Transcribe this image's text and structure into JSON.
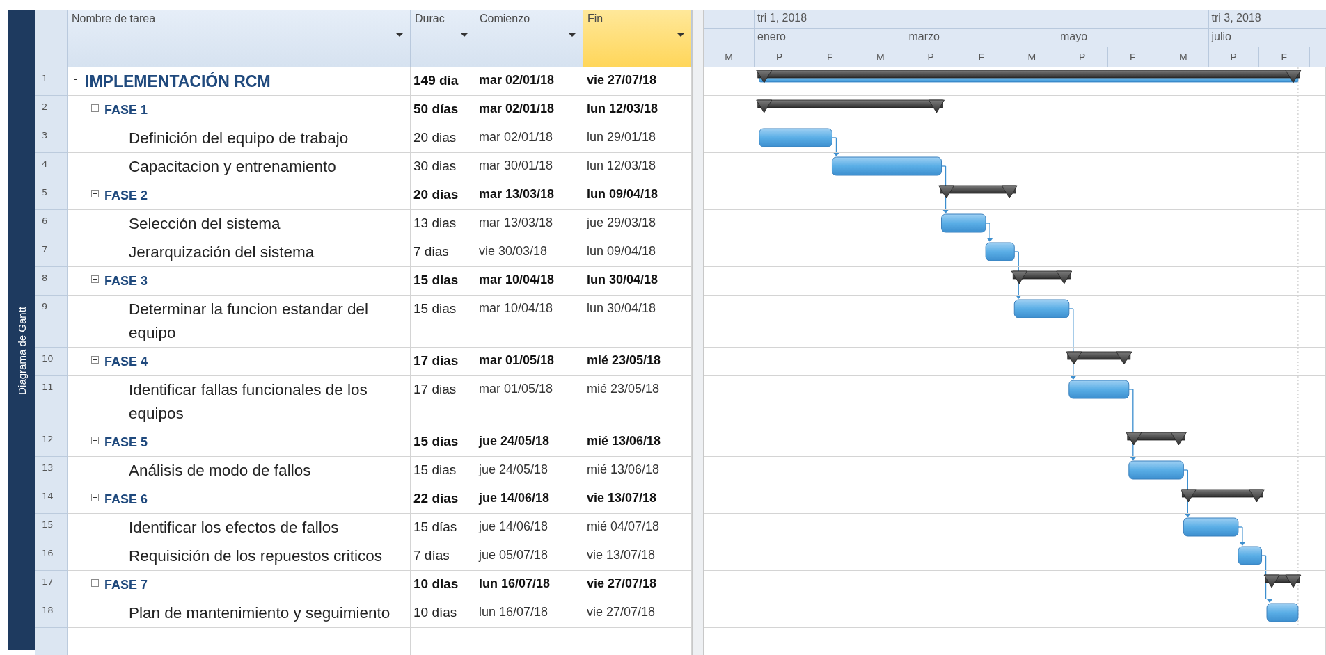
{
  "side_label": "Diagrama de Gantt",
  "table": {
    "columns": [
      {
        "label": "Nombre de tarea",
        "selected": false
      },
      {
        "label": "Durac",
        "selected": false
      },
      {
        "label": "Comienzo",
        "selected": false
      },
      {
        "label": "Fin",
        "selected": true
      }
    ],
    "rows": [
      {
        "id": "1",
        "name": "IMPLEMENTACIÓN RCM",
        "duration": "149 día",
        "start": "mar 02/01/18",
        "finish": "vie 27/07/18",
        "kind": "summary",
        "expanded": true,
        "children": [
          {
            "id": "2",
            "name": "FASE 1",
            "duration": "50 días",
            "start": "mar 02/01/18",
            "finish": "lun 12/03/18",
            "kind": "summary",
            "expanded": true,
            "children": [
              {
                "id": "3",
                "name": "Definición del equipo de trabajo",
                "duration": "20 dias",
                "start": "mar 02/01/18",
                "finish": "lun 29/01/18",
                "kind": "task"
              },
              {
                "id": "4",
                "name": "Capacitacion y entrenamiento",
                "duration": "30 dias",
                "start": "mar 30/01/18",
                "finish": "lun 12/03/18",
                "kind": "task"
              }
            ]
          },
          {
            "id": "5",
            "name": "FASE 2",
            "duration": "20 dias",
            "start": "mar 13/03/18",
            "finish": "lun 09/04/18",
            "kind": "summary",
            "expanded": true,
            "children": [
              {
                "id": "6",
                "name": "Selección del sistema",
                "duration": "13 dias",
                "start": "mar 13/03/18",
                "finish": "jue 29/03/18",
                "kind": "task"
              },
              {
                "id": "7",
                "name": "Jerarquización del sistema",
                "duration": "7 dias",
                "start": "vie 30/03/18",
                "finish": "lun 09/04/18",
                "kind": "task"
              }
            ]
          },
          {
            "id": "8",
            "name": "FASE 3",
            "duration": "15 dias",
            "start": "mar 10/04/18",
            "finish": "lun 30/04/18",
            "kind": "summary",
            "expanded": true,
            "children": [
              {
                "id": "9",
                "name": "Determinar la funcion estandar del equipo",
                "duration": "15 dias",
                "start": "mar 10/04/18",
                "finish": "lun 30/04/18",
                "kind": "task"
              }
            ]
          },
          {
            "id": "10",
            "name": "FASE 4",
            "duration": "17 dias",
            "start": "mar 01/05/18",
            "finish": "mié 23/05/18",
            "kind": "summary",
            "expanded": true,
            "children": [
              {
                "id": "11",
                "name": "Identificar fallas funcionales de los equipos",
                "duration": "17 dias",
                "start": "mar 01/05/18",
                "finish": "mié 23/05/18",
                "kind": "task"
              }
            ]
          },
          {
            "id": "12",
            "name": "FASE 5",
            "duration": "15 dias",
            "start": "jue 24/05/18",
            "finish": "mié 13/06/18",
            "kind": "summary",
            "expanded": true,
            "children": [
              {
                "id": "13",
                "name": "Análisis de modo de fallos",
                "duration": "15 dias",
                "start": "jue 24/05/18",
                "finish": "mié 13/06/18",
                "kind": "task"
              }
            ]
          },
          {
            "id": "14",
            "name": "FASE 6",
            "duration": "22 dias",
            "start": "jue 14/06/18",
            "finish": "vie 13/07/18",
            "kind": "summary",
            "expanded": true,
            "children": [
              {
                "id": "15",
                "name": "Identificar los efectos de fallos",
                "duration": "15 días",
                "start": "jue 14/06/18",
                "finish": "mié 04/07/18",
                "kind": "task"
              },
              {
                "id": "16",
                "name": "Requisición de los repuestos criticos",
                "duration": "7 días",
                "start": "jue 05/07/18",
                "finish": "vie 13/07/18",
                "kind": "task"
              }
            ]
          },
          {
            "id": "17",
            "name": "FASE 7",
            "duration": "10 dias",
            "start": "lun 16/07/18",
            "finish": "vie 27/07/18",
            "kind": "summary",
            "expanded": true,
            "children": [
              {
                "id": "18",
                "name": "Plan de mantenimiento y seguimiento",
                "duration": "10 días",
                "start": "lun 16/07/18",
                "finish": "vie 27/07/18",
                "kind": "task"
              }
            ]
          }
        ]
      }
    ]
  },
  "timescale": {
    "tiers": [
      [
        "tri 1, 2018",
        "tri 3, 2018"
      ],
      [
        "enero",
        "marzo",
        "mayo",
        "julio"
      ],
      [
        "M",
        "P",
        "F",
        "M",
        "P",
        "F",
        "M",
        "P",
        "F",
        "M",
        "P",
        "F"
      ]
    ]
  }
}
